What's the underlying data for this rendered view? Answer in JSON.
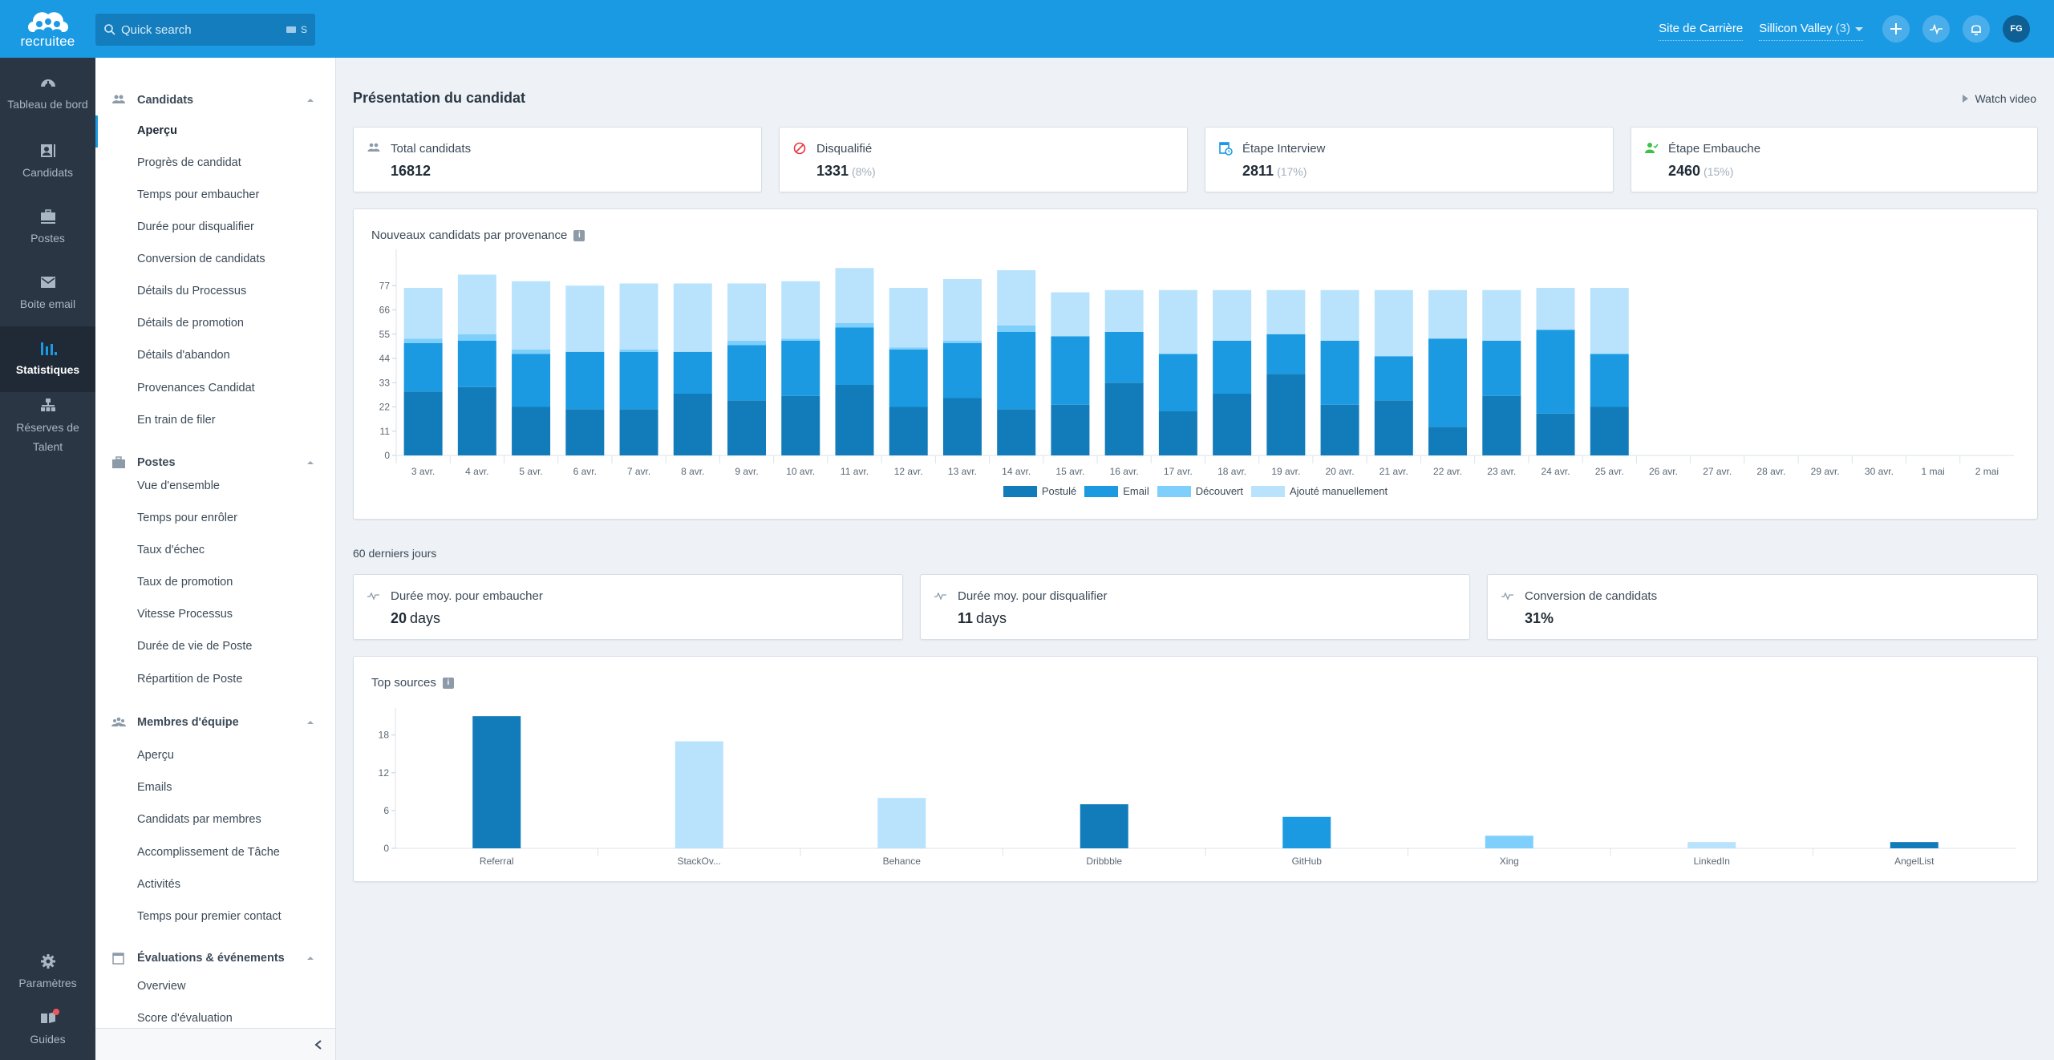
{
  "topbar": {
    "logo_text": "recruitee",
    "search_placeholder": "Quick search",
    "search_shortcut": "S",
    "career_site_link": "Site de Carrière",
    "company_name": "Sillicon Valley",
    "company_count": "(3)",
    "avatar_initials": "FG",
    "icons": [
      "plus-icon",
      "activity-icon",
      "bell-icon"
    ]
  },
  "rail": {
    "items": [
      {
        "label": "Tableau de bord",
        "icon": "dashboard-icon"
      },
      {
        "label": "Candidats",
        "icon": "candidate-card-icon"
      },
      {
        "label": "Postes",
        "icon": "briefcase-icon"
      },
      {
        "label": "Boite email",
        "icon": "mail-icon"
      },
      {
        "label": "Statistiques",
        "icon": "bar-chart-icon",
        "active": true
      },
      {
        "label": "Réserves de Talent",
        "icon": "org-chart-icon"
      },
      {
        "label": "Paramètres",
        "icon": "gear-icon"
      },
      {
        "label": "Guides",
        "icon": "book-icon",
        "badge": true
      }
    ]
  },
  "subnav": {
    "sections": [
      {
        "title": "Candidats",
        "icon": "people-icon",
        "items": [
          "Aperçu",
          "Progrès de candidat",
          "Temps pour embaucher",
          "Durée pour disqualifier",
          "Conversion de candidats",
          "Détails du Processus",
          "Détails de promotion",
          "Détails d'abandon",
          "Provenances Candidat",
          "En train de filer"
        ],
        "active_index": 0
      },
      {
        "title": "Postes",
        "icon": "briefcase-icon",
        "items": [
          "Vue d'ensemble",
          "Temps pour enrôler",
          "Taux d'échec",
          "Taux de promotion",
          "Vitesse Processus",
          "Durée de vie de Poste",
          "Répartition de Poste"
        ]
      },
      {
        "title": "Membres d'équipe",
        "icon": "team-icon",
        "items": [
          "Aperçu",
          "Emails",
          "Candidats par membres",
          "Accomplissement de Tâche",
          "Activités",
          "Temps pour premier contact"
        ]
      },
      {
        "title": "Évaluations & événements",
        "icon": "calendar-icon",
        "items": [
          "Overview",
          "Score d'évaluation"
        ]
      }
    ]
  },
  "main": {
    "title": "Présentation du candidat",
    "watch_video": "Watch video",
    "stats": [
      {
        "label": "Total candidats",
        "value": "16812",
        "pct": "",
        "icon": "people-icon",
        "color": "#8d9aa7"
      },
      {
        "label": "Disqualifié",
        "value": "1331",
        "pct": "(8%)",
        "icon": "ban-icon",
        "color": "#e5363f"
      },
      {
        "label": "Étape Interview",
        "value": "2811",
        "pct": "(17%)",
        "icon": "interview-calendar-icon",
        "color": "#1b9ae4"
      },
      {
        "label": "Étape Embauche",
        "value": "2460",
        "pct": "(15%)",
        "icon": "hired-person-icon",
        "color": "#3cc24a"
      }
    ],
    "period_note": "60 derniers jours",
    "kpis": [
      {
        "label": "Durée moy. pour embaucher",
        "value": "20",
        "unit": "days"
      },
      {
        "label": "Durée moy. pour disqualifier",
        "value": "11",
        "unit": "days"
      },
      {
        "label": "Conversion de candidats",
        "value": "31%",
        "unit": ""
      }
    ]
  },
  "chart_data": [
    {
      "type": "bar",
      "stacked": true,
      "title": "Nouveaux candidats par provenance",
      "xlabel": "",
      "ylabel": "",
      "ylim": [
        0,
        88
      ],
      "yticks": [
        0,
        11,
        22,
        33,
        44,
        55,
        66,
        77
      ],
      "grid": false,
      "legend_position": "bottom",
      "categories": [
        "3 avr.",
        "4 avr.",
        "5 avr.",
        "6 avr.",
        "7 avr.",
        "8 avr.",
        "9 avr.",
        "10 avr.",
        "11 avr.",
        "12 avr.",
        "13 avr.",
        "14 avr.",
        "15 avr.",
        "16 avr.",
        "17 avr.",
        "18 avr.",
        "19 avr.",
        "20 avr.",
        "21 avr.",
        "22 avr.",
        "23 avr.",
        "24 avr.",
        "25 avr.",
        "26 avr.",
        "27 avr.",
        "28 avr.",
        "29 avr.",
        "30 avr.",
        "1 mai",
        "2 mai"
      ],
      "series": [
        {
          "name": "Postulé",
          "color": "#127cba",
          "values": [
            29,
            31,
            22,
            21,
            21,
            28,
            25,
            27,
            32,
            22,
            26,
            21,
            23,
            33,
            20,
            28,
            37,
            23,
            25,
            13,
            27,
            19,
            22,
            0,
            0,
            0,
            0,
            0,
            0,
            0
          ]
        },
        {
          "name": "Email",
          "color": "#1b9ae2",
          "values": [
            22,
            21,
            24,
            26,
            26,
            19,
            25,
            25,
            26,
            26,
            25,
            35,
            31,
            23,
            26,
            24,
            18,
            29,
            20,
            40,
            25,
            38,
            24,
            0,
            0,
            0,
            0,
            0,
            0,
            0
          ]
        },
        {
          "name": "Découvert",
          "color": "#7fcffc",
          "values": [
            2,
            3,
            2,
            0,
            1,
            0,
            2,
            1,
            2,
            1,
            1,
            3,
            0,
            0,
            0,
            0,
            0,
            0,
            0,
            0,
            0,
            0,
            0,
            0,
            0,
            0,
            0,
            0,
            0,
            0
          ]
        },
        {
          "name": "Ajouté manuellement",
          "color": "#b9e3fd",
          "values": [
            23,
            27,
            31,
            30,
            30,
            31,
            26,
            26,
            25,
            27,
            28,
            25,
            20,
            19,
            29,
            23,
            20,
            23,
            30,
            22,
            23,
            19,
            30,
            0,
            0,
            0,
            0,
            0,
            0,
            0
          ]
        }
      ]
    },
    {
      "type": "bar",
      "title": "Top sources",
      "xlabel": "",
      "ylabel": "",
      "ylim": [
        0,
        22
      ],
      "yticks": [
        0,
        6,
        12,
        18
      ],
      "grid": false,
      "categories": [
        "Referral",
        "StackOv...",
        "Behance",
        "Dribbble",
        "GitHub",
        "Xing",
        "LinkedIn",
        "AngelList"
      ],
      "values": [
        21,
        17,
        8,
        7,
        5,
        2,
        1,
        1
      ],
      "colors": [
        "#127cba",
        "#b9e3fd",
        "#b9e3fd",
        "#127cba",
        "#1b9ae2",
        "#7fcffc",
        "#b9e3fd",
        "#127cba"
      ]
    }
  ]
}
